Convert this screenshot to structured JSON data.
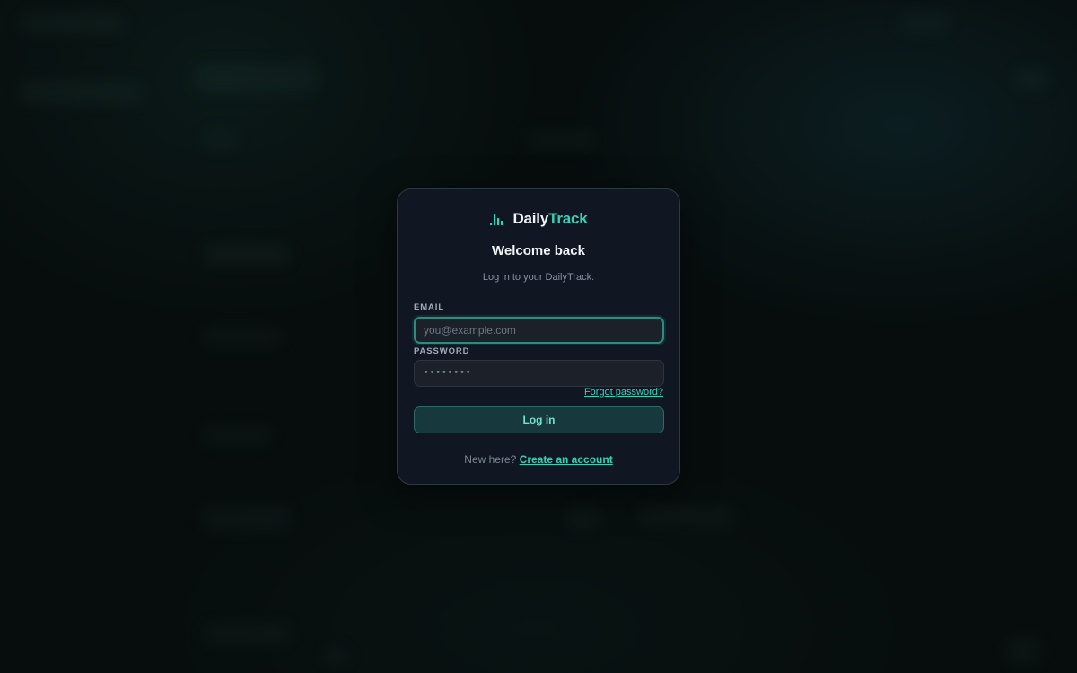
{
  "brand": {
    "name_part1": "Daily",
    "name_part2": "Track",
    "icon": "bar-chart-logo-icon",
    "accent_color": "#35d2ba"
  },
  "login": {
    "title": "Welcome back",
    "subtitle": "Log in to your DailyTrack.",
    "email": {
      "label": "EMAIL",
      "placeholder": "you@example.com",
      "value": ""
    },
    "password": {
      "label": "PASSWORD",
      "masked_value": "••••••••"
    },
    "forgot_link": "Forgot password?",
    "submit_label": "Log in",
    "footer_prompt": "New here?",
    "create_account_link": "Create an account"
  },
  "colors": {
    "background": "#070d0d",
    "card": "#101722",
    "accent": "#35d2ba",
    "button_bg": "#17383d"
  }
}
